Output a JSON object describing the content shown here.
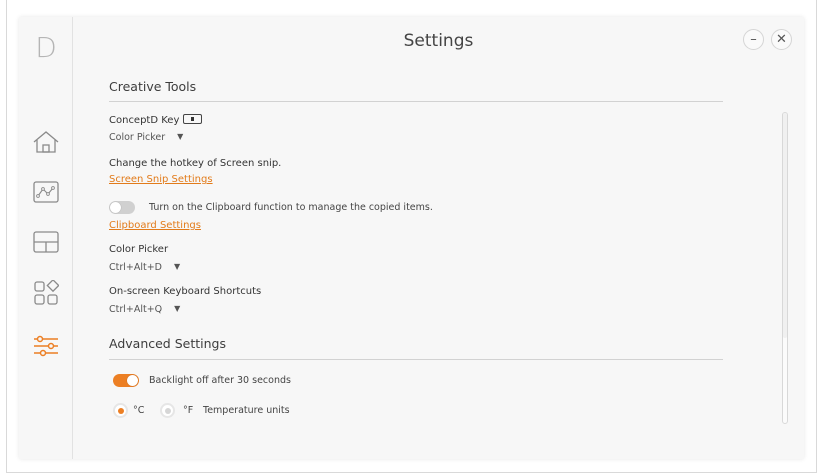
{
  "window": {
    "title": "Settings",
    "logo": "D"
  },
  "sidebar": {
    "items": [
      {
        "name": "home",
        "active": false
      },
      {
        "name": "creative-graph",
        "active": false
      },
      {
        "name": "layout",
        "active": false
      },
      {
        "name": "apps",
        "active": false
      },
      {
        "name": "settings",
        "active": true
      }
    ]
  },
  "creative_tools": {
    "section_title": "Creative Tools",
    "conceptd_key": {
      "label": "ConceptD Key",
      "value": "Color Picker"
    },
    "screen_snip": {
      "label": "Change the hotkey of Screen snip.",
      "link": "Screen Snip Settings"
    },
    "clipboard": {
      "toggle_label": "Turn on the Clipboard function to manage the copied items.",
      "enabled": false,
      "link": "Clipboard Settings"
    },
    "color_picker": {
      "label": "Color Picker",
      "value": "Ctrl+Alt+D"
    },
    "onscreen_keyboard": {
      "label": "On-screen Keyboard Shortcuts",
      "value": "Ctrl+Alt+Q"
    }
  },
  "advanced": {
    "section_title": "Advanced Settings",
    "backlight": {
      "label": "Backlight off after 30 seconds",
      "enabled": true
    },
    "temperature": {
      "celsius": "°C",
      "fahrenheit": "°F",
      "label": "Temperature units",
      "selected": "celsius"
    }
  },
  "colors": {
    "accent": "#ec7f24",
    "link": "#e27b1a"
  }
}
